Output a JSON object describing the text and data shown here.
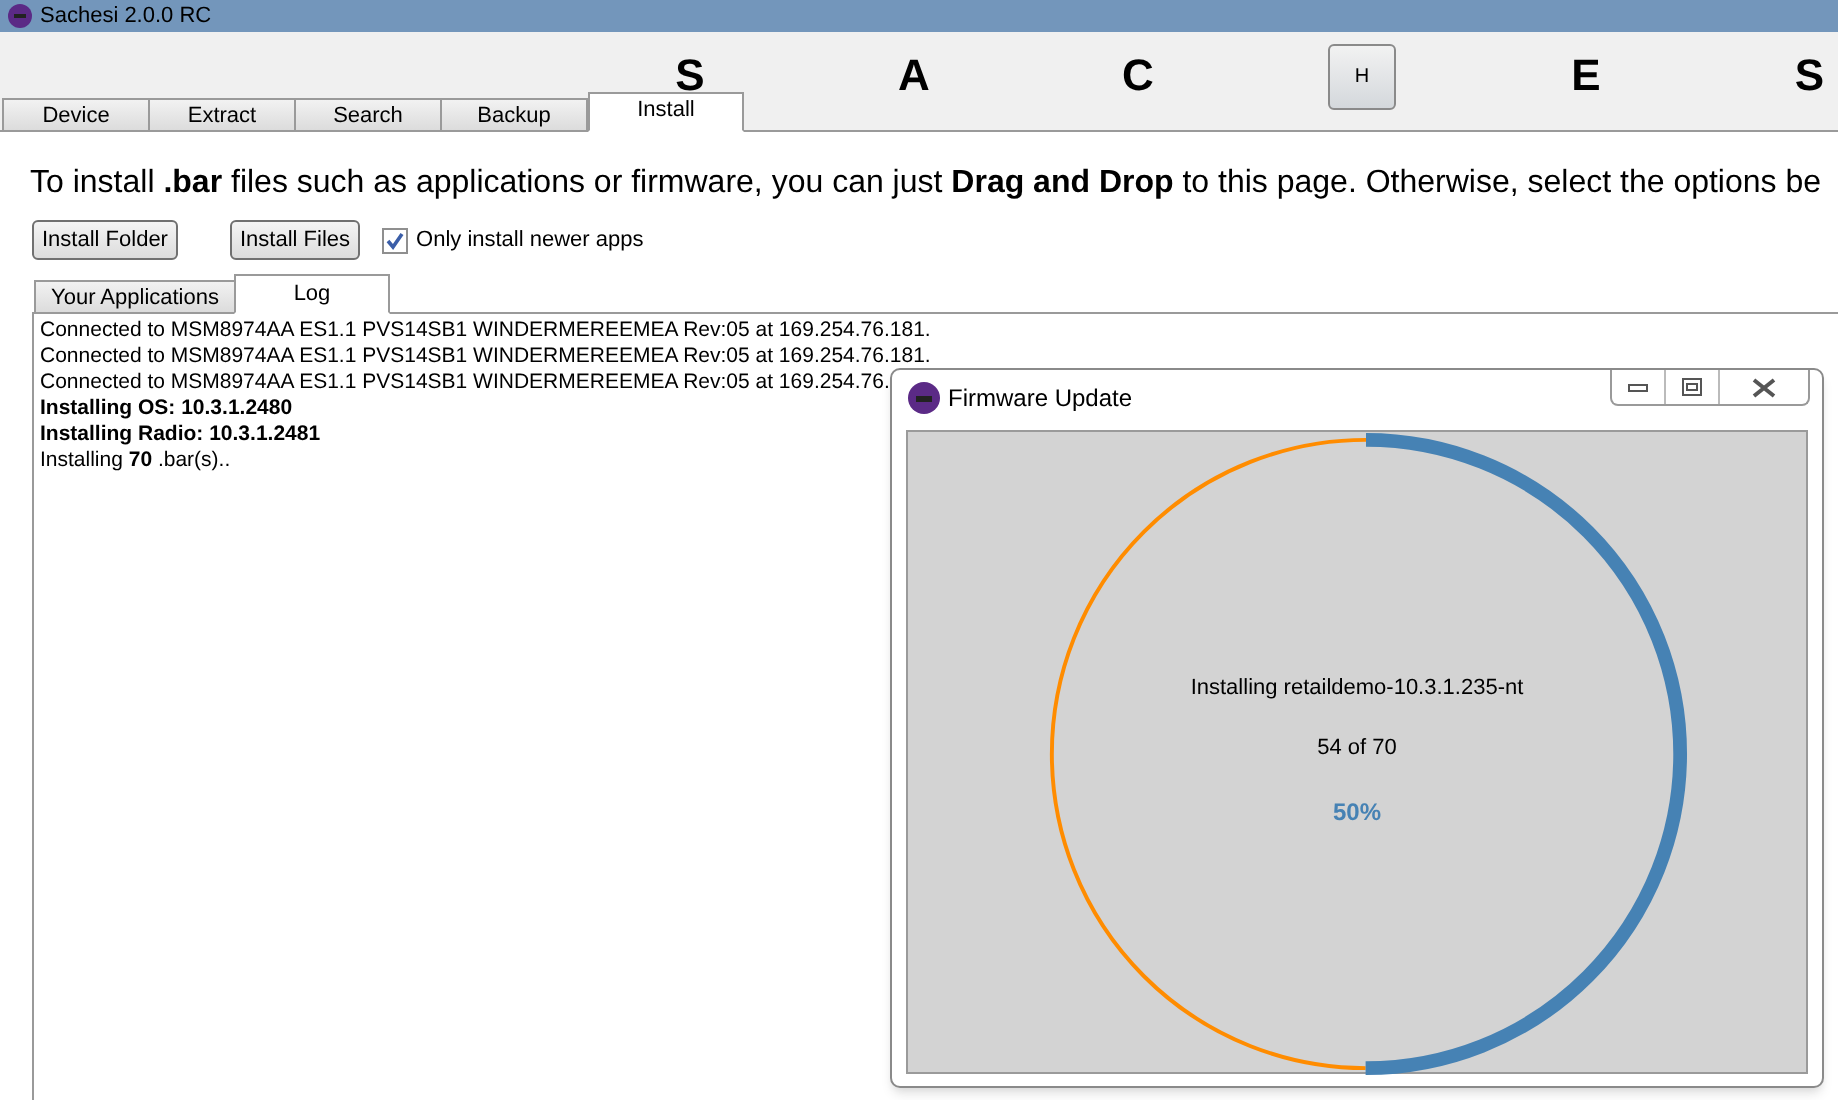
{
  "window": {
    "title": "Sachesi 2.0.0 RC"
  },
  "header_letters": [
    {
      "text": "S",
      "kind": "letter"
    },
    {
      "text": "A",
      "kind": "letter"
    },
    {
      "text": "C",
      "kind": "letter"
    },
    {
      "text": "H",
      "kind": "button"
    },
    {
      "text": "E",
      "kind": "letter"
    },
    {
      "text": "S",
      "kind": "letter"
    }
  ],
  "tabs": [
    {
      "label": "Device",
      "selected": false
    },
    {
      "label": "Extract",
      "selected": false
    },
    {
      "label": "Search",
      "selected": false
    },
    {
      "label": "Backup",
      "selected": false
    },
    {
      "label": "Install",
      "selected": true
    }
  ],
  "intro": "To install **.bar** files such as applications or firmware, you can just **Drag and Drop** to this page. Otherwise, select the options be",
  "buttons": [
    "Install Folder",
    "Install Files"
  ],
  "newer_only": {
    "label": "Only install newer apps",
    "checked": true
  },
  "subtabs": [
    {
      "label": "Your Applications",
      "selected": false
    },
    {
      "label": "Log",
      "selected": true
    }
  ],
  "log": [
    "Connected to MSM8974AA ES1.1 PVS14SB1 WINDERMEREEMEA Rev:05 at 169.254.76.181.",
    "Connected to MSM8974AA ES1.1 PVS14SB1 WINDERMEREEMEA Rev:05 at 169.254.76.181.",
    "Connected to MSM8974AA ES1.1 PVS14SB1 WINDERMEREEMEA Rev:05 at 169.254.76.",
    "**Installing OS: 10.3.1.2480**",
    "**Installing Radio: 10.3.1.2481**",
    "Installing **70** .bar(s).."
  ],
  "dialog": {
    "title": "Firmware Update",
    "status": "Installing retaildemo-10.3.1.235-nt",
    "count": "54 of 70",
    "percent": "50%",
    "level": 0.5
  }
}
